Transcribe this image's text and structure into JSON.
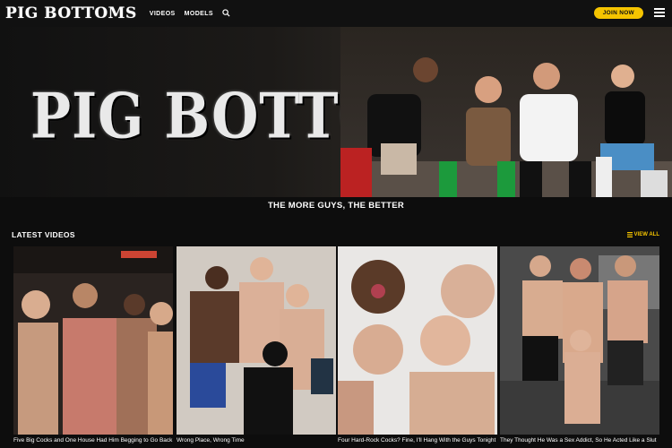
{
  "header": {
    "logo": "PIG BOTTOMS",
    "nav": [
      {
        "label": "VIDEOS"
      },
      {
        "label": "MODELS"
      }
    ],
    "join_label": "JOIN NOW",
    "search_icon": "search-icon",
    "menu_icon": "hamburger-menu-icon"
  },
  "hero": {
    "title": "PIG BOTTOMS",
    "tagline": "THE MORE GUYS, THE BETTER"
  },
  "latest": {
    "title": "LATEST VIDEOS",
    "view_all": "VIEW ALL",
    "videos": [
      {
        "title": "Five Big Cocks and One House Had Him Begging to Go Back"
      },
      {
        "title": "Wrong Place, Wrong Time"
      },
      {
        "title": "Four Hard-Rock Cocks? Fine, I'll Hang With the Guys Tonight"
      },
      {
        "title": "They Thought He Was a Sex Addict, So He Acted Like a Slut"
      }
    ]
  },
  "colors": {
    "accent": "#f5c400",
    "background": "#0d0d0d",
    "topbar": "#111111"
  }
}
